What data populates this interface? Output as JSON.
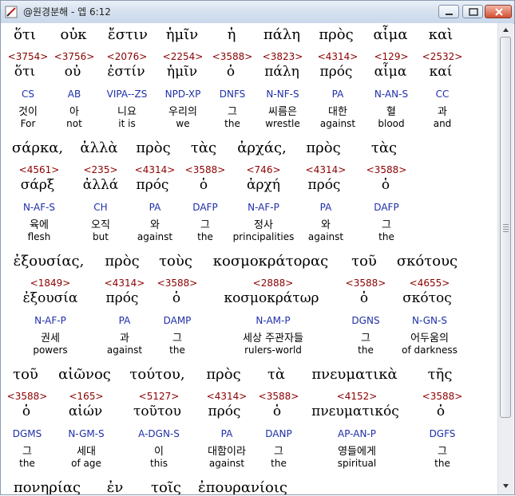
{
  "window": {
    "title": "@원경분해 - 엡 6:12"
  },
  "rows": [
    {
      "words": [
        {
          "greek": "ὅτι",
          "strong": "<3754>",
          "lemma": "ὅτι",
          "morph": "CS",
          "kor": "것이",
          "eng": "For"
        },
        {
          "greek": "οὐκ",
          "strong": "<3756>",
          "lemma": "οὐ",
          "morph": "AB",
          "kor": "아",
          "eng": "not"
        },
        {
          "greek": "ἔστιν",
          "strong": "<2076>",
          "lemma": "ἐστίν",
          "morph": "VIPA--ZS",
          "kor": "니요",
          "eng": "it is"
        },
        {
          "greek": "ἡμῖν",
          "strong": "<2254>",
          "lemma": "ἡμῖν",
          "morph": "NPD-XP",
          "kor": "우리의",
          "eng": "we"
        },
        {
          "greek": "ἡ",
          "strong": "<3588>",
          "lemma": "ὁ",
          "morph": "DNFS",
          "kor": "그",
          "eng": "the"
        },
        {
          "greek": "πάλη",
          "strong": "<3823>",
          "lemma": "πάλη",
          "morph": "N-NF-S",
          "kor": "씨름은",
          "eng": "wrestle"
        },
        {
          "greek": "πρὸς",
          "strong": "<4314>",
          "lemma": "πρός",
          "morph": "PA",
          "kor": "대한",
          "eng": "against"
        },
        {
          "greek": "αἷμα",
          "strong": "<129>",
          "lemma": "αἷμα",
          "morph": "N-AN-S",
          "kor": "혈",
          "eng": "blood"
        },
        {
          "greek": "καὶ",
          "strong": "<2532>",
          "lemma": "καί",
          "morph": "CC",
          "kor": "과",
          "eng": "and"
        }
      ]
    },
    {
      "words": [
        {
          "greek": "σάρκα,",
          "strong": "<4561>",
          "lemma": "σάρξ",
          "morph": "N-AF-S",
          "kor": "육에",
          "eng": "flesh"
        },
        {
          "greek": "ἀλλὰ",
          "strong": "<235>",
          "lemma": "ἀλλά",
          "morph": "CH",
          "kor": "오직",
          "eng": "but"
        },
        {
          "greek": "πρὸς",
          "strong": "<4314>",
          "lemma": "πρός",
          "morph": "PA",
          "kor": "와",
          "eng": "against"
        },
        {
          "greek": "τὰς",
          "strong": "<3588>",
          "lemma": "ὁ",
          "morph": "DAFP",
          "kor": "그",
          "eng": "the"
        },
        {
          "greek": "ἀρχάς,",
          "strong": "<746>",
          "lemma": "ἀρχή",
          "morph": "N-AF-P",
          "kor": "정사",
          "eng": "principalities"
        },
        {
          "greek": "πρὸς",
          "strong": "<4314>",
          "lemma": "πρός",
          "morph": "PA",
          "kor": "와",
          "eng": "against"
        },
        {
          "greek": "τὰς",
          "strong": "<3588>",
          "lemma": "ὁ",
          "morph": "DAFP",
          "kor": "그",
          "eng": "the"
        }
      ]
    },
    {
      "words": [
        {
          "greek": "ἐξουσίας,",
          "strong": "<1849>",
          "lemma": "ἐξουσία",
          "morph": "N-AF-P",
          "kor": "권세",
          "eng": "powers"
        },
        {
          "greek": "πρὸς",
          "strong": "<4314>",
          "lemma": "πρός",
          "morph": "PA",
          "kor": "과",
          "eng": "against"
        },
        {
          "greek": "τοὺς",
          "strong": "<3588>",
          "lemma": "ὁ",
          "morph": "DAMP",
          "kor": "그",
          "eng": "the"
        },
        {
          "greek": "κοσμοκράτορας",
          "strong": "<2888>",
          "lemma": "κοσμοκράτωρ",
          "morph": "N-AM-P",
          "kor": "세상 주관자들",
          "eng": "rulers-world"
        },
        {
          "greek": "τοῦ",
          "strong": "<3588>",
          "lemma": "ὁ",
          "morph": "DGNS",
          "kor": "그",
          "eng": "the"
        },
        {
          "greek": "σκότους",
          "strong": "<4655>",
          "lemma": "σκότος",
          "morph": "N-GN-S",
          "kor": "어두움의",
          "eng": "of darkness"
        }
      ]
    },
    {
      "words": [
        {
          "greek": "τοῦ",
          "strong": "<3588>",
          "lemma": "ὁ",
          "morph": "DGMS",
          "kor": "그",
          "eng": "the"
        },
        {
          "greek": "αἰῶνος",
          "strong": "<165>",
          "lemma": "αἰών",
          "morph": "N-GM-S",
          "kor": "세대",
          "eng": "of age"
        },
        {
          "greek": "τούτου,",
          "strong": "<5127>",
          "lemma": "τοῦτου",
          "morph": "A-DGN-S",
          "kor": "이",
          "eng": "this"
        },
        {
          "greek": "πρὸς",
          "strong": "<4314>",
          "lemma": "πρός",
          "morph": "PA",
          "kor": "대함이라",
          "eng": "against"
        },
        {
          "greek": "τὰ",
          "strong": "<3588>",
          "lemma": "ὁ",
          "morph": "DANP",
          "kor": "그",
          "eng": "the"
        },
        {
          "greek": "πνευματικὰ",
          "strong": "<4152>",
          "lemma": "πνευματικός",
          "morph": "AP-AN-P",
          "kor": "영들에게",
          "eng": "spiritual"
        },
        {
          "greek": "τῆς",
          "strong": "<3588>",
          "lemma": "ὁ",
          "morph": "DGFS",
          "kor": "그",
          "eng": "the"
        }
      ]
    },
    {
      "words": [
        {
          "greek": "πονηρίας",
          "strong": "",
          "lemma": "",
          "morph": "",
          "kor": "",
          "eng": ""
        },
        {
          "greek": "ἐν",
          "strong": "",
          "lemma": "",
          "morph": "",
          "kor": "",
          "eng": ""
        },
        {
          "greek": "τοῖς",
          "strong": "",
          "lemma": "",
          "morph": "",
          "kor": "",
          "eng": ""
        },
        {
          "greek": "ἐπουρανίοις",
          "strong": "",
          "lemma": "",
          "morph": "",
          "kor": "",
          "eng": ""
        }
      ]
    }
  ],
  "colors": {
    "strong": "#8b0000",
    "morph": "#1f2fa8",
    "title_bg": "#d7e2ef"
  },
  "icons": {
    "app": "pen-icon",
    "minimize": "minimize-icon",
    "maximize": "maximize-icon",
    "close": "close-icon"
  }
}
